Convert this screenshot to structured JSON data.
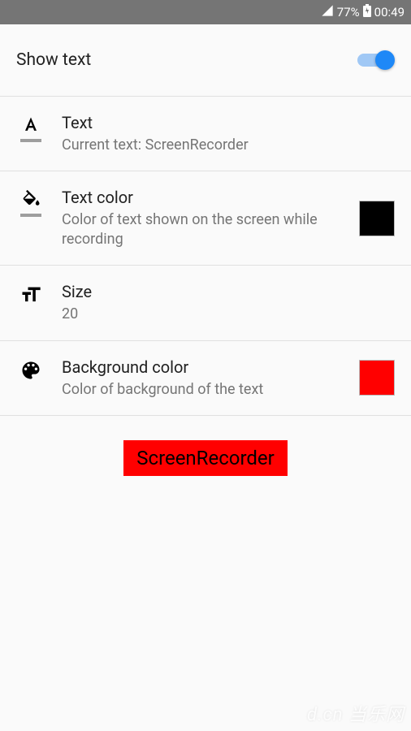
{
  "status": {
    "battery": "77%",
    "time": "00:49"
  },
  "header": {
    "title": "Show text",
    "toggle_on": true
  },
  "text_setting": {
    "label": "Text",
    "sub": "Current text: ScreenRecorder"
  },
  "text_color_setting": {
    "label": "Text color",
    "sub": "Color of text shown on the screen while recording",
    "color": "#000000"
  },
  "size_setting": {
    "label": "Size",
    "sub": "20"
  },
  "bg_color_setting": {
    "label": "Background color",
    "sub": "Color of background of the text",
    "color": "#ff0000"
  },
  "preview": {
    "text": "ScreenRecorder"
  },
  "watermark": "d.cn 当乐网"
}
